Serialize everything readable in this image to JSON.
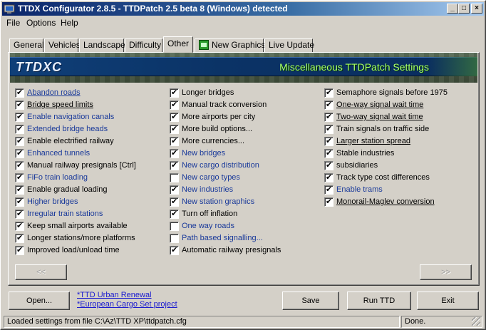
{
  "window": {
    "title": "TTDX Configurator 2.8.5 - TTDPatch 2.5 beta 8 (Windows) detected",
    "controls": {
      "minimize": "_",
      "maximize": "□",
      "close": "×"
    }
  },
  "menu": [
    {
      "label": "File"
    },
    {
      "label": "Options"
    },
    {
      "label": "Help"
    }
  ],
  "tabs": [
    {
      "label": "General"
    },
    {
      "label": "Vehicles"
    },
    {
      "label": "Landscape"
    },
    {
      "label": "Difficulty"
    },
    {
      "label": "Other",
      "active": true
    },
    {
      "label": "New Graphics",
      "icon": "new-graphics-icon"
    },
    {
      "label": "Live Update"
    }
  ],
  "banner": {
    "logo": "TTDXC",
    "heading": "Miscellaneous TTDPatch Settings"
  },
  "options": {
    "col1": [
      {
        "label": "Abandon roads",
        "checked": true,
        "style": "link-underline"
      },
      {
        "label": "Bridge speed limits",
        "checked": true,
        "style": "underline"
      },
      {
        "label": "Enable navigation canals",
        "checked": true,
        "style": "link"
      },
      {
        "label": "Extended bridge heads",
        "checked": true,
        "style": "link"
      },
      {
        "label": "Enable electrified railway",
        "checked": true,
        "style": "plain"
      },
      {
        "label": "Enhanced tunnels",
        "checked": true,
        "style": "link"
      },
      {
        "label": "Manual railway presignals [Ctrl]",
        "checked": true,
        "style": "plain"
      },
      {
        "label": "FiFo train loading",
        "checked": true,
        "style": "link"
      },
      {
        "label": "Enable gradual loading",
        "checked": true,
        "style": "plain"
      },
      {
        "label": "Higher bridges",
        "checked": true,
        "style": "link"
      },
      {
        "label": "Irregular train stations",
        "checked": true,
        "style": "link"
      },
      {
        "label": "Keep small airports available",
        "checked": true,
        "style": "plain"
      },
      {
        "label": "Longer stations/more platforms",
        "checked": true,
        "style": "plain"
      },
      {
        "label": "Improved load/unload time",
        "checked": true,
        "style": "plain"
      }
    ],
    "col2": [
      {
        "label": "Longer bridges",
        "checked": true,
        "style": "plain"
      },
      {
        "label": "Manual track conversion",
        "checked": true,
        "style": "plain"
      },
      {
        "label": "More airports per city",
        "checked": true,
        "style": "plain"
      },
      {
        "label": "More build options...",
        "checked": true,
        "style": "plain"
      },
      {
        "label": "More currencies...",
        "checked": true,
        "style": "plain"
      },
      {
        "label": "New bridges",
        "checked": true,
        "style": "link"
      },
      {
        "label": "New cargo distribution",
        "checked": true,
        "style": "link"
      },
      {
        "label": "New cargo types",
        "checked": false,
        "style": "link"
      },
      {
        "label": "New industries",
        "checked": true,
        "style": "link"
      },
      {
        "label": "New station graphics",
        "checked": true,
        "style": "link"
      },
      {
        "label": "Turn off inflation",
        "checked": true,
        "style": "plain"
      },
      {
        "label": "One way roads",
        "checked": false,
        "style": "link"
      },
      {
        "label": "Path based signalling...",
        "checked": false,
        "style": "link"
      },
      {
        "label": "Automatic railway presignals",
        "checked": true,
        "style": "plain"
      }
    ],
    "col3": [
      {
        "label": "Semaphore signals before 1975",
        "checked": true,
        "style": "plain"
      },
      {
        "label": "One-way signal wait time",
        "checked": true,
        "style": "underline"
      },
      {
        "label": "Two-way signal wait time",
        "checked": true,
        "style": "underline"
      },
      {
        "label": "Train signals on traffic side",
        "checked": true,
        "style": "plain"
      },
      {
        "label": "Larger station spread",
        "checked": true,
        "style": "underline"
      },
      {
        "label": "Stable industries",
        "checked": true,
        "style": "plain"
      },
      {
        "label": "subsidiaries",
        "checked": true,
        "style": "plain"
      },
      {
        "label": "Track type cost differences",
        "checked": true,
        "style": "plain"
      },
      {
        "label": "Enable trams",
        "checked": true,
        "style": "link"
      },
      {
        "label": "Monorail-Maglev conversion",
        "checked": true,
        "style": "underline"
      }
    ]
  },
  "pager": {
    "prev": "<<",
    "next": ">>"
  },
  "bottom": {
    "open": "Open...",
    "links": [
      "*TTD Urban Renewal",
      "*European Cargo Set project"
    ],
    "save": "Save",
    "run": "Run TTD",
    "exit": "Exit"
  },
  "status": {
    "left": "Loaded settings from file C:\\Az\\TTD XP\\ttdpatch.cfg",
    "right": "Done."
  },
  "colors": {
    "titlebar_start": "#0a246a",
    "titlebar_end": "#a6caf0",
    "link_text": "#1a3a9a",
    "banner_heading": "#a8ff6a"
  }
}
